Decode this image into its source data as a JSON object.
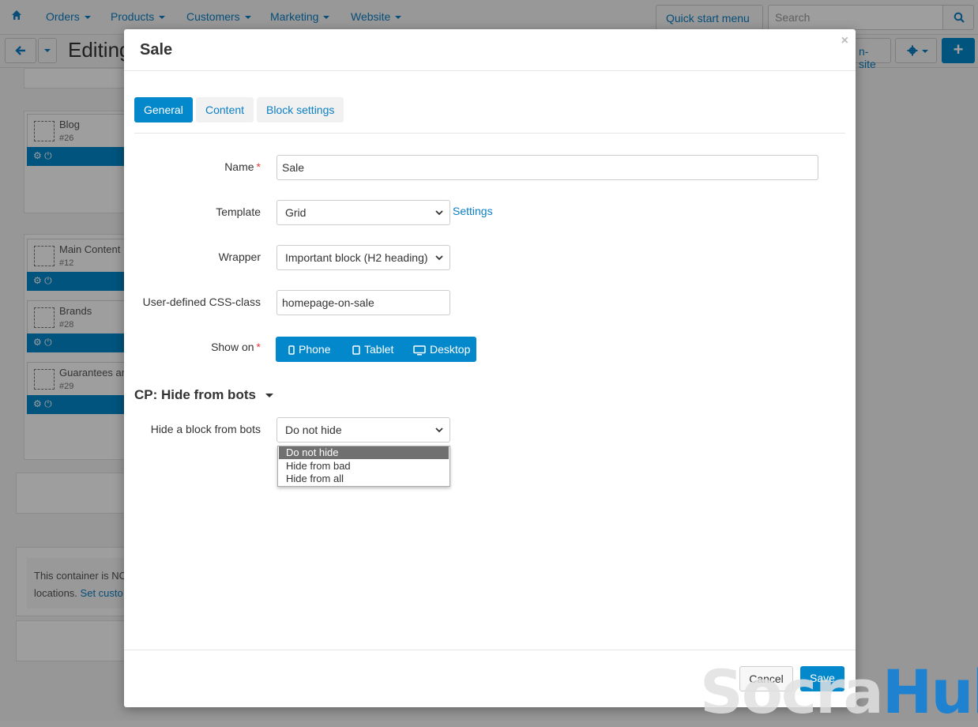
{
  "topnav": {
    "items": [
      "Orders",
      "Products",
      "Customers",
      "Marketing",
      "Website"
    ],
    "quick_start": "Quick start menu",
    "search_placeholder": "Search"
  },
  "toolbar": {
    "title": "Editing",
    "onsite_label": "n-site"
  },
  "blocks": [
    {
      "name": "Blog",
      "id": "#26"
    },
    {
      "name": "Main Content",
      "id": "#12"
    },
    {
      "name": "Brands",
      "id": "#28"
    },
    {
      "name": "Guarantees an",
      "id": "#29"
    }
  ],
  "notice": {
    "line1": "This container is NO",
    "line2_prefix": "locations.",
    "line2_link": "Set custo"
  },
  "modal": {
    "title": "Sale",
    "close_glyph": "×",
    "tabs": [
      {
        "label": "General",
        "active": true
      },
      {
        "label": "Content",
        "active": false
      },
      {
        "label": "Block settings",
        "active": false
      }
    ],
    "fields": {
      "name_label": "Name",
      "name_value": "Sale",
      "template_label": "Template",
      "template_value": "Grid",
      "settings_link": "Settings",
      "wrapper_label": "Wrapper",
      "wrapper_value": "Important block (H2 heading)",
      "css_label": "User-defined CSS-class",
      "css_value": "homepage-on-sale",
      "showon_label": "Show on",
      "required_mark": "*",
      "devices": [
        "Phone",
        "Tablet",
        "Desktop"
      ]
    },
    "section": {
      "title": "CP: Hide from bots",
      "hide_label": "Hide a block from bots",
      "hide_value": "Do not hide",
      "hide_options": [
        "Do not hide",
        "Hide from bad",
        "Hide from all"
      ],
      "hide_selected_index": 0
    },
    "footer": {
      "cancel": "Cancel",
      "save": "Save"
    }
  },
  "watermark": {
    "part1": "Socra",
    "part2": "Hub"
  },
  "colors": {
    "accent": "#0388cc",
    "link": "#0b7fc3",
    "required": "#e53935"
  }
}
